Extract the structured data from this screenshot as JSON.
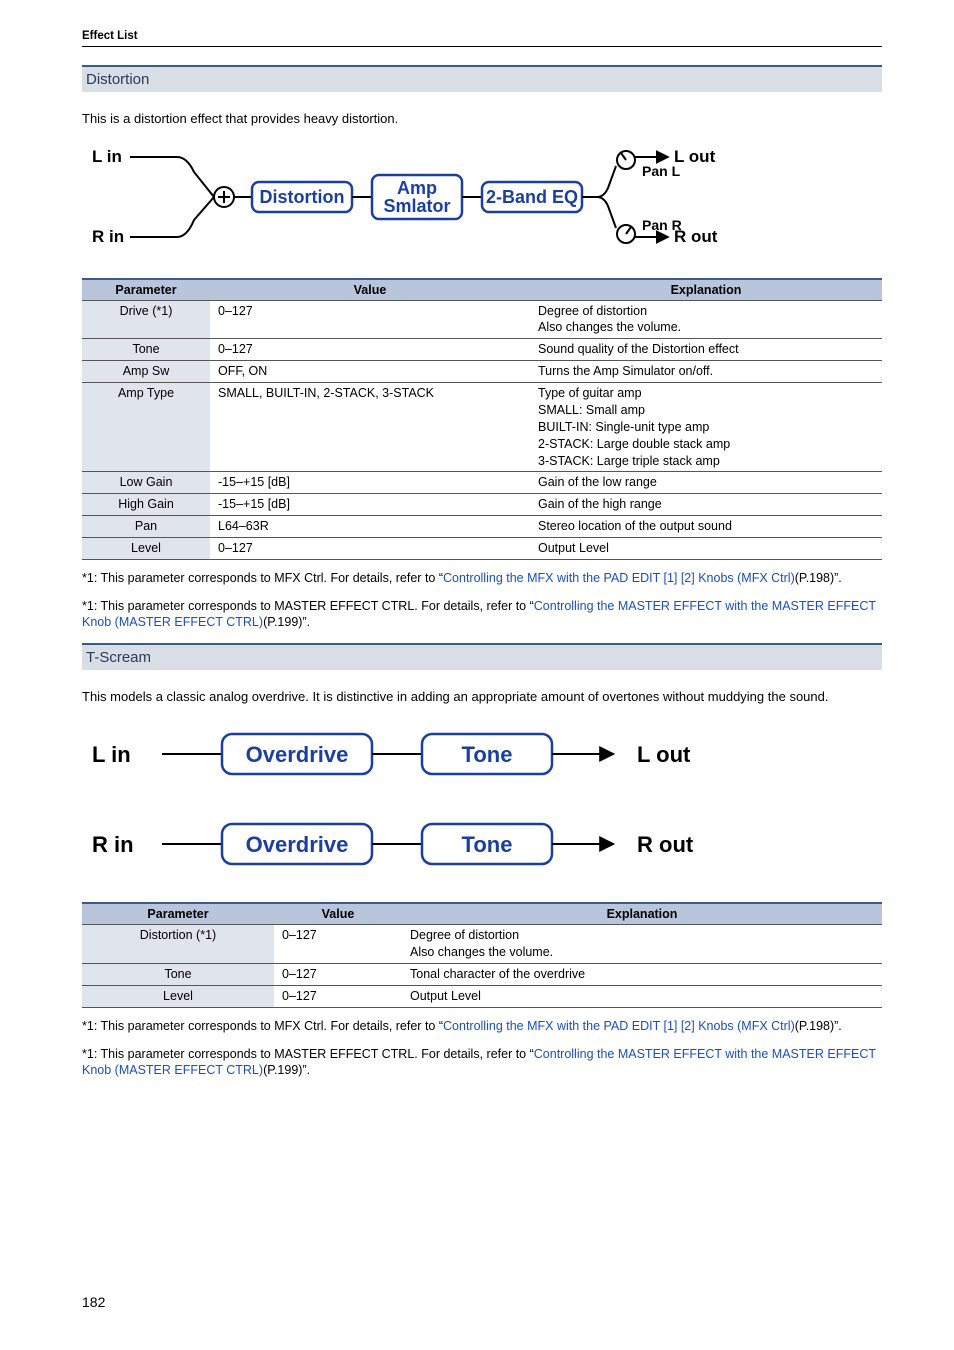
{
  "header": {
    "breadcrumb": "Effect List"
  },
  "page_number": "182",
  "sections": {
    "distortion": {
      "title": "Distortion",
      "intro": "This is a distortion effect that provides heavy distortion.",
      "diagram": {
        "l_in": "L in",
        "r_in": "R in",
        "l_out": "L out",
        "r_out": "R out",
        "pan_l": "Pan L",
        "pan_r": "Pan R",
        "block1": "Distortion",
        "block2_top": "Amp",
        "block2_bot": "Smlator",
        "block3": "2-Band EQ"
      },
      "table": {
        "headers": {
          "param": "Parameter",
          "value": "Value",
          "expl": "Explanation"
        },
        "rows": [
          {
            "param": "Drive (*1)",
            "value": "0–127",
            "expl": "Degree of distortion\nAlso changes the volume."
          },
          {
            "param": "Tone",
            "value": "0–127",
            "expl": "Sound quality of the Distortion effect"
          },
          {
            "param": "Amp Sw",
            "value": "OFF, ON",
            "expl": "Turns the Amp Simulator on/off."
          },
          {
            "param": "Amp Type",
            "value": "SMALL, BUILT-IN, 2-STACK, 3-STACK",
            "expl": "Type of guitar amp\nSMALL: Small amp\nBUILT-IN: Single-unit type amp\n2-STACK: Large double stack amp\n3-STACK: Large triple stack amp"
          },
          {
            "param": "Low Gain",
            "value": "-15–+15 [dB]",
            "expl": "Gain of the low range"
          },
          {
            "param": "High Gain",
            "value": "-15–+15 [dB]",
            "expl": "Gain of the high range"
          },
          {
            "param": "Pan",
            "value": "L64–63R",
            "expl": "Stereo location of the output sound"
          },
          {
            "param": "Level",
            "value": "0–127",
            "expl": "Output Level"
          }
        ]
      },
      "footnotes": [
        {
          "pre": "*1: This parameter corresponds to MFX Ctrl. For details, refer to “",
          "link": "Controlling the MFX with the PAD EDIT [1] [2] Knobs (MFX Ctrl)",
          "post": "(P.198)”."
        },
        {
          "pre": "*1: This parameter corresponds to MASTER EFFECT CTRL. For details, refer to “",
          "link": "Controlling the MASTER EFFECT with the MASTER EFFECT Knob (MASTER EFFECT CTRL)",
          "post": "(P.199)”."
        }
      ]
    },
    "tscream": {
      "title": "T-Scream",
      "intro": "This models a classic analog overdrive. It is distinctive in adding an appropriate amount of overtones without muddying the sound.",
      "diagram": {
        "l_in": "L in",
        "r_in": "R in",
        "l_out": "L out",
        "r_out": "R out",
        "block1": "Overdrive",
        "block2": "Tone"
      },
      "table": {
        "headers": {
          "param": "Parameter",
          "value": "Value",
          "expl": "Explanation"
        },
        "rows": [
          {
            "param": "Distortion (*1)",
            "value": "0–127",
            "expl": "Degree of distortion\nAlso changes the volume."
          },
          {
            "param": "Tone",
            "value": "0–127",
            "expl": "Tonal character of the overdrive"
          },
          {
            "param": "Level",
            "value": "0–127",
            "expl": "Output Level"
          }
        ]
      },
      "footnotes": [
        {
          "pre": "*1: This parameter corresponds to MFX Ctrl. For details, refer to “",
          "link": "Controlling the MFX with the PAD EDIT [1] [2] Knobs (MFX Ctrl)",
          "post": "(P.198)”."
        },
        {
          "pre": "*1: This parameter corresponds to MASTER EFFECT CTRL. For details, refer to “",
          "link": "Controlling the MASTER EFFECT with the MASTER EFFECT Knob (MASTER EFFECT CTRL)",
          "post": "(P.199)”."
        }
      ]
    }
  }
}
